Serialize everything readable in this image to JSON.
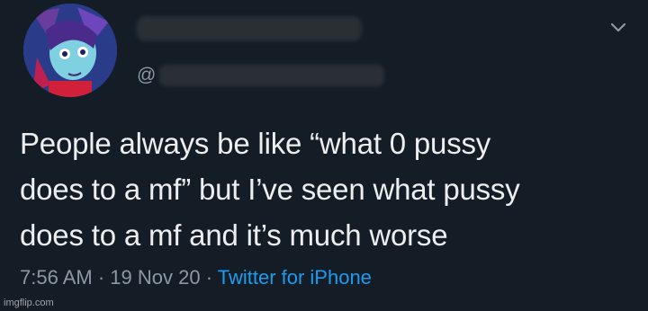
{
  "tweet": {
    "handle_prefix": "@",
    "text_lines": [
      "People always be like “what 0 pussy",
      "does to a mf” but I’ve seen what pussy",
      "does to a mf and it’s much worse"
    ],
    "time": "7:56 AM",
    "separator": " · ",
    "date": "19 Nov 20",
    "source": "Twitter for iPhone"
  },
  "icons": {
    "avatar": "anime-character-avatar",
    "more": "chevron-down-icon"
  },
  "colors": {
    "background": "#141d26",
    "text": "#eceef0",
    "muted": "#8b98a5",
    "link": "#1d9bf0"
  },
  "watermark": "imgflip.com"
}
